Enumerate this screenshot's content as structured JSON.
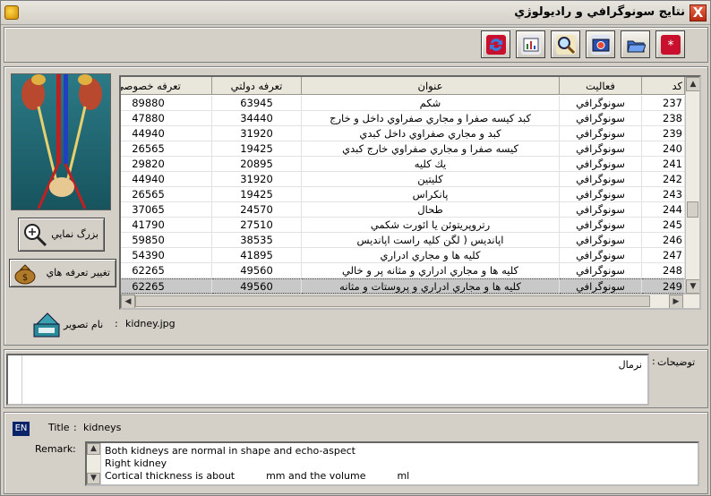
{
  "window": {
    "title": "نتايج سونوگرافي و راديولوژي",
    "close_glyph": "X"
  },
  "toolbar": {
    "icons": [
      "refresh-icon",
      "report-icon",
      "search-icon",
      "camera-icon",
      "folder-icon",
      "new-icon"
    ]
  },
  "side": {
    "zoom_label": "بزرگ نمايي",
    "tariff_label": "تغيير تعرفه هاي"
  },
  "image": {
    "label": "نام تصوير",
    "separator": ":",
    "filename": "kidney.jpg"
  },
  "table": {
    "columns": [
      "كد",
      "فعاليت",
      "عنوان",
      "تعرفه دولتي",
      "تعرفه خصوصي"
    ],
    "rows": [
      [
        "237",
        "سونوگرافي",
        "شكم",
        "63945",
        "89880"
      ],
      [
        "238",
        "سونوگرافي",
        "كبد كيسه صفرا و مجاري صفراوي داخل و خارج",
        "34440",
        "47880"
      ],
      [
        "239",
        "سونوگرافي",
        "كبد و مجاري صفراوي داخل كبدي",
        "31920",
        "44940"
      ],
      [
        "240",
        "سونوگرافي",
        "كيسه صفرا و مجاري صفراوي خارج كبدي",
        "19425",
        "26565"
      ],
      [
        "241",
        "سونوگرافي",
        "يك كليه",
        "20895",
        "29820"
      ],
      [
        "242",
        "سونوگرافي",
        "كليتين",
        "31920",
        "44940"
      ],
      [
        "243",
        "سونوگرافي",
        "پانكراس",
        "19425",
        "26565"
      ],
      [
        "244",
        "سونوگرافي",
        "طحال",
        "24570",
        "37065"
      ],
      [
        "245",
        "سونوگرافي",
        "رتروپريتوئن يا ائورت شكمي",
        "27510",
        "41790"
      ],
      [
        "246",
        "سونوگرافي",
        "اپانديس ( لگن  كليه راست  اپانديس",
        "38535",
        "59850"
      ],
      [
        "247",
        "سونوگرافي",
        "كليه ها و مجاري ادراري",
        "41895",
        "54390"
      ],
      [
        "248",
        "سونوگرافي",
        "كليه ها و مجاري ادراري و مثانه پر و خالي",
        "49560",
        "62265"
      ],
      [
        "249",
        "سونوگرافي",
        "كليه ها و مجاري ادراري و پروستات و مثانه",
        "49560",
        "62265"
      ]
    ]
  },
  "description": {
    "label": "توضيحات",
    "separator": ":",
    "value": "نرمال"
  },
  "english": {
    "badge": "EN",
    "title_label": "Title",
    "separator": ":",
    "title_value": "kidneys",
    "remark_label": "Remark",
    "remark_lines": [
      "Both kidneys are normal in shape and echo-aspect",
      "Right kidney",
      "Cortical thickness is about          mm and the volume          ml"
    ]
  }
}
